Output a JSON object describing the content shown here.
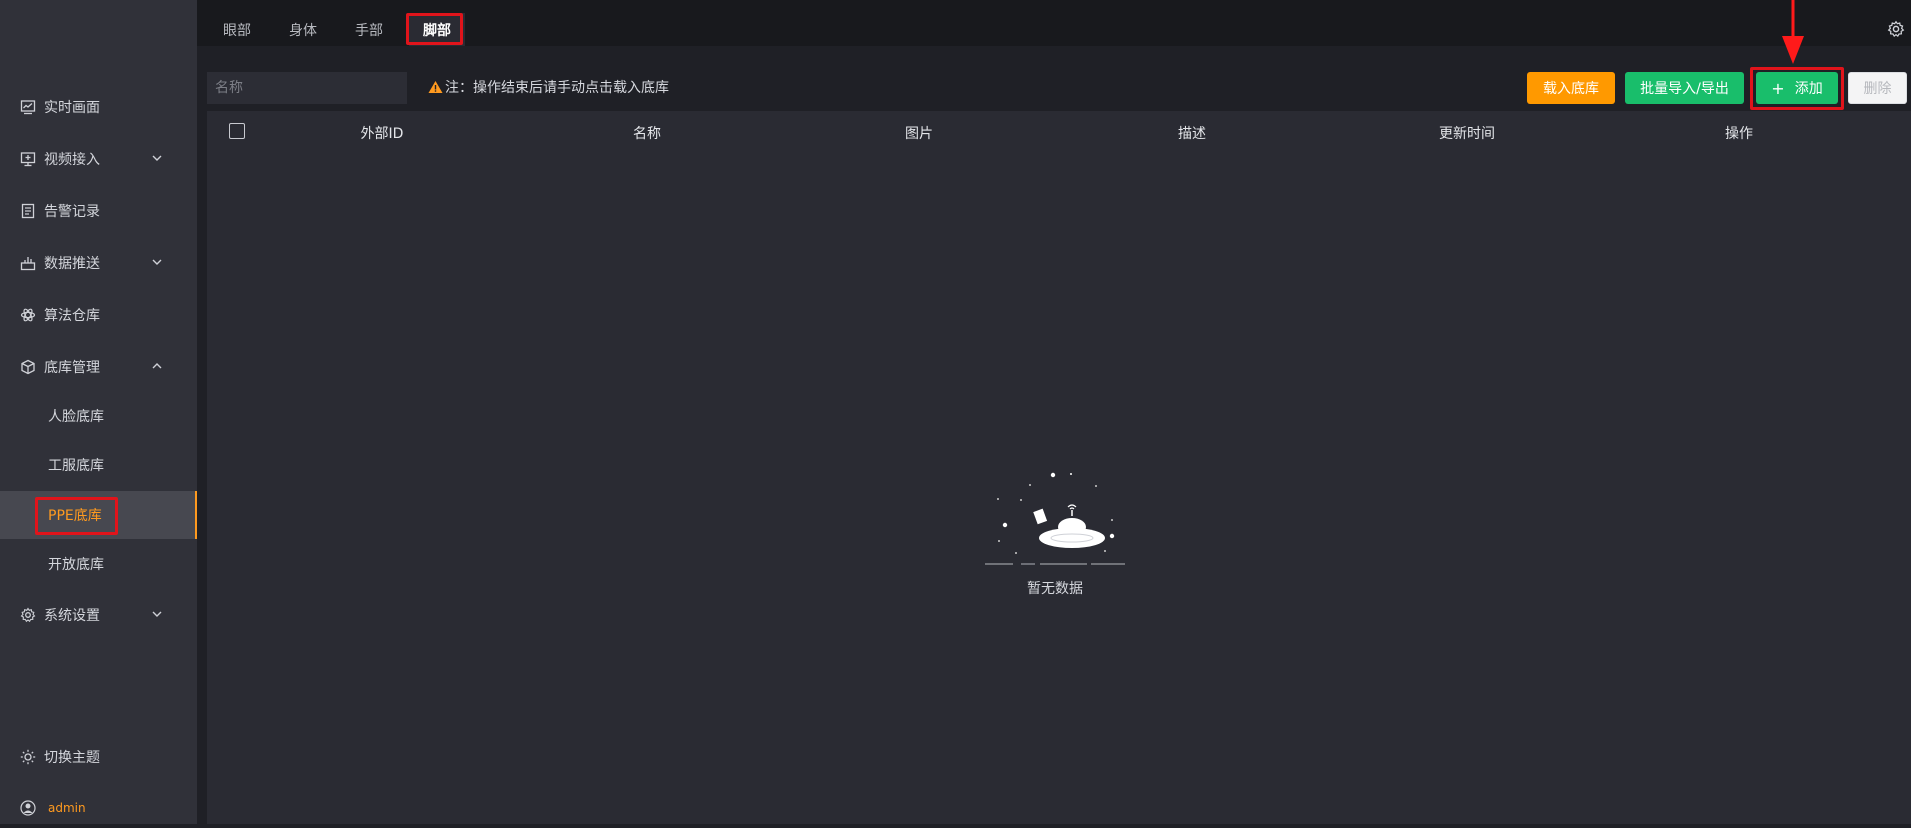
{
  "sidebar": {
    "items": [
      {
        "label": "实时画面",
        "icon": "monitor-chart-icon"
      },
      {
        "label": "视频接入",
        "icon": "screen-icon"
      },
      {
        "label": "告警记录",
        "icon": "document-icon"
      },
      {
        "label": "数据推送",
        "icon": "upload-chart-icon"
      },
      {
        "label": "算法仓库",
        "icon": "algorithm-icon"
      },
      {
        "label": "底库管理",
        "icon": "cube-icon"
      },
      {
        "label": "系统设置",
        "icon": "gear-icon"
      }
    ],
    "sub_items": [
      {
        "label": "人脸底库"
      },
      {
        "label": "工服底库"
      },
      {
        "label": "PPE底库"
      },
      {
        "label": "开放底库"
      }
    ],
    "theme_label": "切换主题",
    "user_name": "admin"
  },
  "tabs": [
    {
      "label": "眼部"
    },
    {
      "label": "身体"
    },
    {
      "label": "手部"
    },
    {
      "label": "脚部"
    }
  ],
  "toolbar": {
    "search_placeholder": "名称",
    "note": "注：操作结束后请手动点击载入底库",
    "load_label": "载入底库",
    "batch_label": "批量导入/导出",
    "add_label": "添加",
    "delete_label": "删除"
  },
  "table": {
    "columns": [
      "外部ID",
      "名称",
      "图片",
      "描述",
      "更新时间",
      "操作"
    ],
    "rows": [],
    "empty_text": "暂无数据"
  },
  "colors": {
    "accent": "#ff9a1f",
    "primary_green": "#19be6b",
    "highlight_red": "#e0141b",
    "sidebar_bg": "#303139",
    "panel_bg": "#2a2b33"
  }
}
